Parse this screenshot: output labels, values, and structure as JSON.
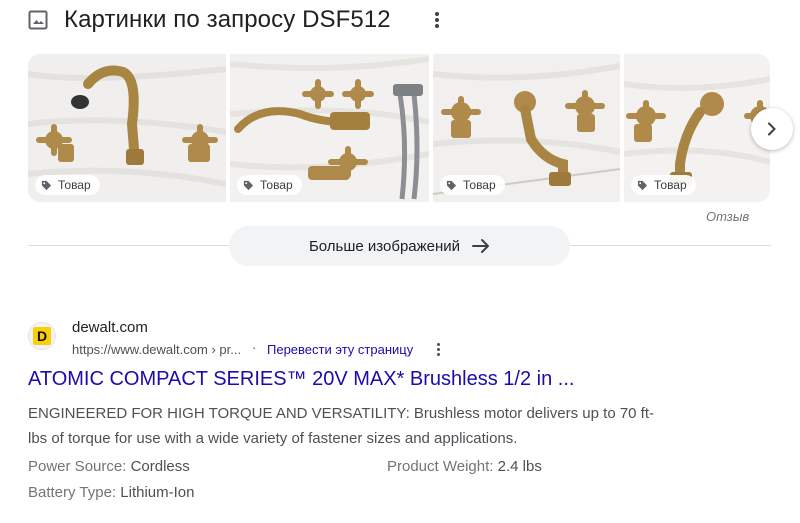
{
  "images_section": {
    "heading": "Картинки по запросу DSF512",
    "thumbnails": [
      {
        "badge": "Товар"
      },
      {
        "badge": "Товар"
      },
      {
        "badge": "Товар"
      },
      {
        "badge": "Товар"
      }
    ],
    "feedback_label": "Отзыв",
    "more_button_label": "Больше изображений"
  },
  "result": {
    "site_name": "dewalt.com",
    "url": "https://www.dewalt.com › pr...",
    "separator": "·",
    "translate_link": "Перевести эту страницу",
    "favicon_letter": "D",
    "title": "ATOMIC COMPACT SERIES™ 20V MAX* Brushless 1/2 in ...",
    "snippet_line1": "ENGINEERED FOR HIGH TORQUE AND VERSATILITY: Brushless motor delivers up to 70 ft-",
    "snippet_line2": "lbs of torque for use with a wide variety of fastener sizes and applications.",
    "specs": [
      {
        "key": "Power Source:",
        "value": "Cordless"
      },
      {
        "key": "Product Weight:",
        "value": "2.4 lbs"
      },
      {
        "key": "Battery Type:",
        "value": "Lithium-Ion"
      }
    ]
  },
  "colors": {
    "link": "#1a0dab",
    "brass": "#b08a4a",
    "favicon_bg": "#fbce07"
  }
}
